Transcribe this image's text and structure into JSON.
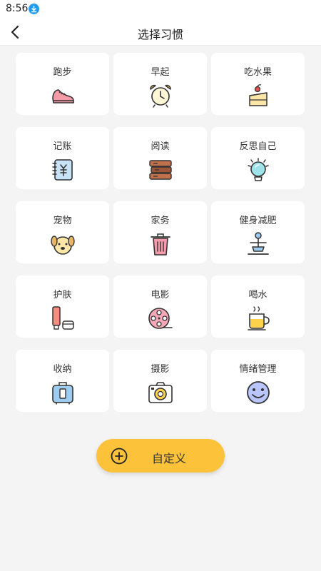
{
  "status": {
    "time": "8:56"
  },
  "header": {
    "title": "选择习惯"
  },
  "habits": [
    {
      "label": "跑步",
      "icon": "running-shoe-icon"
    },
    {
      "label": "早起",
      "icon": "alarm-clock-icon"
    },
    {
      "label": "吃水果",
      "icon": "fruit-cake-icon"
    },
    {
      "label": "记账",
      "icon": "ledger-book-icon"
    },
    {
      "label": "阅读",
      "icon": "books-icon"
    },
    {
      "label": "反思自己",
      "icon": "light-bulb-icon"
    },
    {
      "label": "宠物",
      "icon": "dog-icon"
    },
    {
      "label": "家务",
      "icon": "trash-bin-icon"
    },
    {
      "label": "健身减肥",
      "icon": "fitness-person-icon"
    },
    {
      "label": "护肤",
      "icon": "skincare-icon"
    },
    {
      "label": "电影",
      "icon": "film-reel-icon"
    },
    {
      "label": "喝水",
      "icon": "cup-icon"
    },
    {
      "label": "收纳",
      "icon": "storage-box-icon"
    },
    {
      "label": "摄影",
      "icon": "camera-icon"
    },
    {
      "label": "情绪管理",
      "icon": "smiley-face-icon"
    }
  ],
  "custom_button": {
    "label": "自定义"
  },
  "colors": {
    "accent": "#fcc33a",
    "background": "#f4f4f4",
    "card": "#ffffff"
  }
}
